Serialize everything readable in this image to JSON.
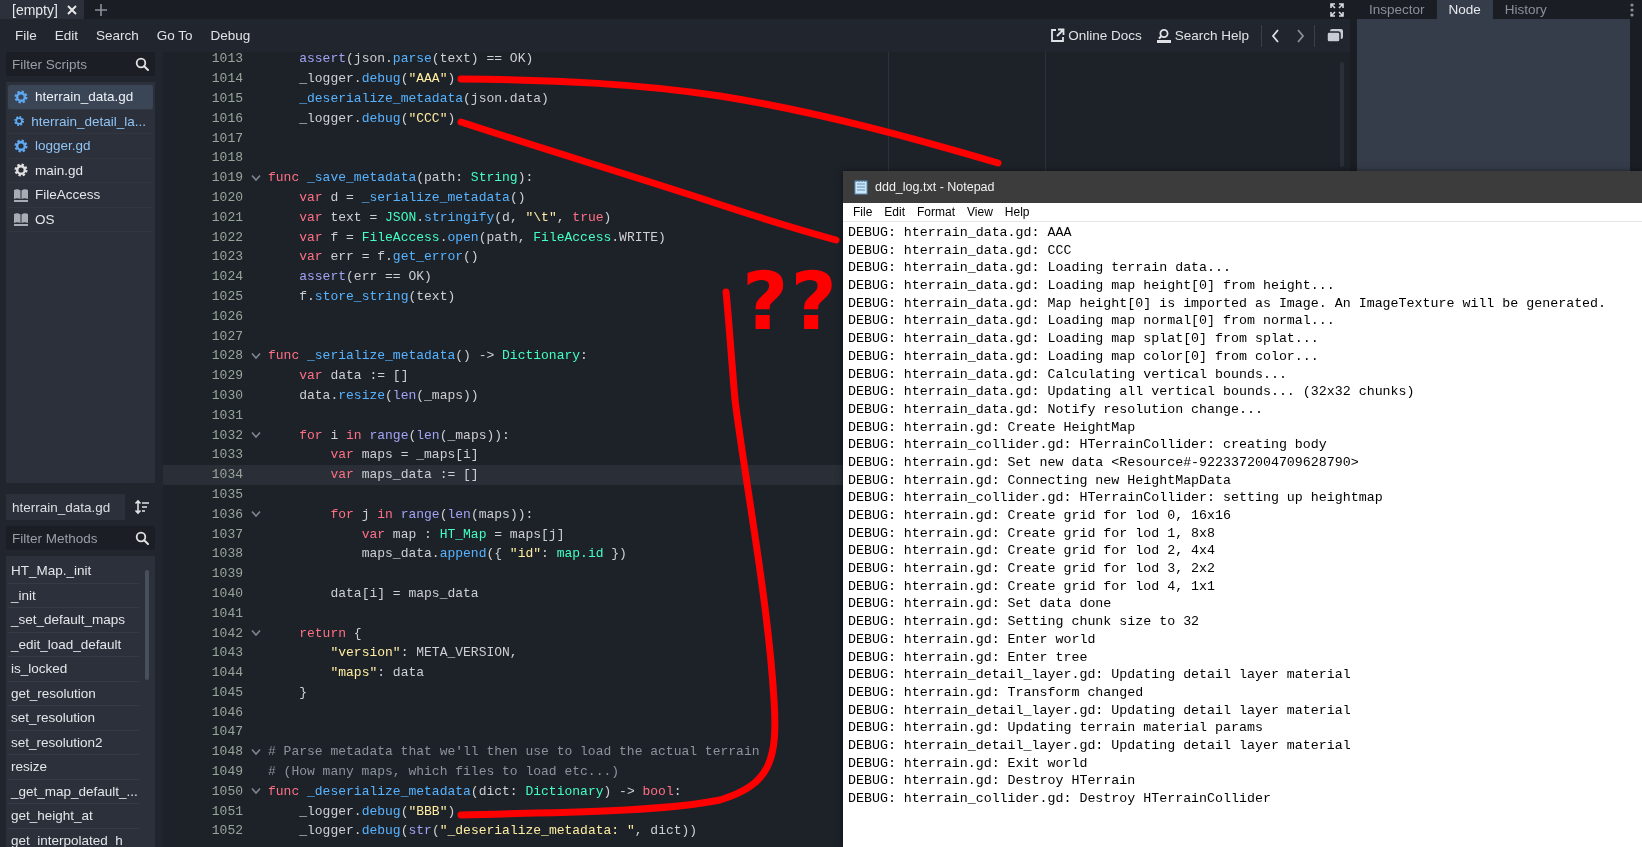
{
  "editor": {
    "tabs": [
      {
        "label": "[empty]",
        "selected": true
      }
    ],
    "menu": [
      "File",
      "Edit",
      "Search",
      "Go To",
      "Debug"
    ],
    "toolbar": [
      {
        "kind": "docs",
        "label": "Online Docs"
      },
      {
        "kind": "help",
        "label": "Search Help"
      }
    ],
    "script_filter": {
      "placeholder": "Filter Scripts"
    },
    "scripts": [
      {
        "name": "hterrain_data.gd",
        "kind": "tool_script",
        "selected": true
      },
      {
        "name": "hterrain_detail_la...",
        "kind": "tool_script",
        "selected": false
      },
      {
        "name": "logger.gd",
        "kind": "tool_script",
        "selected": false
      },
      {
        "name": "main.gd",
        "kind": "script",
        "selected": false
      },
      {
        "name": "FileAccess",
        "kind": "doc",
        "selected": false
      },
      {
        "name": "OS",
        "kind": "doc",
        "selected": false
      }
    ],
    "current_script": "hterrain_data.gd",
    "method_filter": {
      "placeholder": "Filter Methods"
    },
    "methods": [
      "HT_Map._init",
      "_init",
      "_set_default_maps",
      "_edit_load_default",
      "is_locked",
      "get_resolution",
      "set_resolution",
      "set_resolution2",
      "resize",
      "_get_map_default_...",
      "get_height_at",
      "get_interpolated_h"
    ],
    "code": {
      "lines": [
        {
          "number": "1013",
          "foldable": false,
          "selected": false,
          "tokens": [
            {
              "kind": "builtin",
              "text": "\tassert"
            },
            {
              "kind": "plain",
              "text": "(json."
            },
            {
              "kind": "function",
              "text": "parse"
            },
            {
              "kind": "plain",
              "text": "(text) == OK)"
            }
          ]
        },
        {
          "number": "1014",
          "foldable": false,
          "selected": false,
          "tokens": [
            {
              "kind": "plain",
              "text": "\t_logger."
            },
            {
              "kind": "function",
              "text": "debug"
            },
            {
              "kind": "plain",
              "text": "("
            },
            {
              "kind": "string",
              "text": "\"AAA\""
            },
            {
              "kind": "plain",
              "text": ")"
            }
          ]
        },
        {
          "number": "1015",
          "foldable": false,
          "selected": false,
          "tokens": [
            {
              "kind": "function",
              "text": "\t_deserialize_metadata"
            },
            {
              "kind": "plain",
              "text": "(json.data)"
            }
          ]
        },
        {
          "number": "1016",
          "foldable": false,
          "selected": false,
          "tokens": [
            {
              "kind": "plain",
              "text": "\t_logger."
            },
            {
              "kind": "function",
              "text": "debug"
            },
            {
              "kind": "plain",
              "text": "("
            },
            {
              "kind": "string",
              "text": "\"CCC\""
            },
            {
              "kind": "plain",
              "text": ")"
            }
          ]
        },
        {
          "number": "1017",
          "foldable": false,
          "selected": false
        },
        {
          "number": "1018",
          "foldable": false,
          "selected": false
        },
        {
          "number": "1019",
          "foldable": true,
          "selected": false,
          "tokens": [
            {
              "kind": "keyword",
              "text": "func"
            },
            {
              "kind": "function",
              "text": " _save_metadata"
            },
            {
              "kind": "plain",
              "text": "(path: "
            },
            {
              "kind": "type",
              "text": "String"
            },
            {
              "kind": "plain",
              "text": "):"
            }
          ]
        },
        {
          "number": "1020",
          "foldable": false,
          "selected": false,
          "tokens": [
            {
              "kind": "keyword",
              "text": "\tvar"
            },
            {
              "kind": "plain",
              "text": " d = "
            },
            {
              "kind": "function",
              "text": "_serialize_metadata"
            },
            {
              "kind": "plain",
              "text": "()"
            }
          ]
        },
        {
          "number": "1021",
          "foldable": false,
          "selected": false,
          "tokens": [
            {
              "kind": "keyword",
              "text": "\tvar"
            },
            {
              "kind": "plain",
              "text": " text = "
            },
            {
              "kind": "type",
              "text": "JSON"
            },
            {
              "kind": "plain",
              "text": "."
            },
            {
              "kind": "function",
              "text": "stringify"
            },
            {
              "kind": "plain",
              "text": "(d, "
            },
            {
              "kind": "string",
              "text": "\"\\t\""
            },
            {
              "kind": "plain",
              "text": ", "
            },
            {
              "kind": "keyword",
              "text": "true"
            },
            {
              "kind": "plain",
              "text": ")"
            }
          ]
        },
        {
          "number": "1022",
          "foldable": false,
          "selected": false,
          "tokens": [
            {
              "kind": "keyword",
              "text": "\tvar"
            },
            {
              "kind": "plain",
              "text": " f = "
            },
            {
              "kind": "type",
              "text": "FileAccess"
            },
            {
              "kind": "plain",
              "text": "."
            },
            {
              "kind": "function",
              "text": "open"
            },
            {
              "kind": "plain",
              "text": "(path, "
            },
            {
              "kind": "type",
              "text": "FileAccess"
            },
            {
              "kind": "plain",
              "text": ".WRITE)"
            }
          ]
        },
        {
          "number": "1023",
          "foldable": false,
          "selected": false,
          "tokens": [
            {
              "kind": "keyword",
              "text": "\tvar"
            },
            {
              "kind": "plain",
              "text": " err = f."
            },
            {
              "kind": "function",
              "text": "get_error"
            },
            {
              "kind": "plain",
              "text": "()"
            }
          ]
        },
        {
          "number": "1024",
          "foldable": false,
          "selected": false,
          "tokens": [
            {
              "kind": "builtin",
              "text": "\tassert"
            },
            {
              "kind": "plain",
              "text": "(err == OK)"
            }
          ]
        },
        {
          "number": "1025",
          "foldable": false,
          "selected": false,
          "tokens": [
            {
              "kind": "plain",
              "text": "\tf."
            },
            {
              "kind": "function",
              "text": "store_string"
            },
            {
              "kind": "plain",
              "text": "(text)"
            }
          ]
        },
        {
          "number": "1026",
          "foldable": false,
          "selected": false
        },
        {
          "number": "1027",
          "foldable": false,
          "selected": false
        },
        {
          "number": "1028",
          "foldable": true,
          "selected": false,
          "tokens": [
            {
              "kind": "keyword",
              "text": "func"
            },
            {
              "kind": "function",
              "text": " _serialize_metadata"
            },
            {
              "kind": "plain",
              "text": "() -> "
            },
            {
              "kind": "type",
              "text": "Dictionary"
            },
            {
              "kind": "plain",
              "text": ":"
            }
          ]
        },
        {
          "number": "1029",
          "foldable": false,
          "selected": false,
          "tokens": [
            {
              "kind": "keyword",
              "text": "\tvar"
            },
            {
              "kind": "plain",
              "text": " data := []"
            }
          ]
        },
        {
          "number": "1030",
          "foldable": false,
          "selected": false,
          "tokens": [
            {
              "kind": "plain",
              "text": "\tdata."
            },
            {
              "kind": "function",
              "text": "resize"
            },
            {
              "kind": "plain",
              "text": "("
            },
            {
              "kind": "builtin",
              "text": "len"
            },
            {
              "kind": "plain",
              "text": "(_maps))"
            }
          ]
        },
        {
          "number": "1031",
          "foldable": false,
          "selected": false
        },
        {
          "number": "1032",
          "foldable": true,
          "selected": false,
          "tokens": [
            {
              "kind": "keyword",
              "text": "\tfor"
            },
            {
              "kind": "plain",
              "text": " i "
            },
            {
              "kind": "keyword",
              "text": "in"
            },
            {
              "kind": "builtin",
              "text": " range"
            },
            {
              "kind": "plain",
              "text": "("
            },
            {
              "kind": "builtin",
              "text": "len"
            },
            {
              "kind": "plain",
              "text": "(_maps)):"
            }
          ]
        },
        {
          "number": "1033",
          "foldable": false,
          "selected": false,
          "tokens": [
            {
              "kind": "keyword",
              "text": "\t\tvar"
            },
            {
              "kind": "plain",
              "text": " maps = _maps[i]"
            }
          ]
        },
        {
          "number": "1034",
          "foldable": false,
          "selected": true,
          "tokens": [
            {
              "kind": "keyword",
              "text": "\t\tvar"
            },
            {
              "kind": "plain",
              "text": " maps_data := []"
            }
          ]
        },
        {
          "number": "1035",
          "foldable": false,
          "selected": false
        },
        {
          "number": "1036",
          "foldable": true,
          "selected": false,
          "tokens": [
            {
              "kind": "keyword",
              "text": "\t\tfor"
            },
            {
              "kind": "plain",
              "text": " j "
            },
            {
              "kind": "keyword",
              "text": "in"
            },
            {
              "kind": "builtin",
              "text": " range"
            },
            {
              "kind": "plain",
              "text": "("
            },
            {
              "kind": "builtin",
              "text": "len"
            },
            {
              "kind": "plain",
              "text": "(maps)):"
            }
          ]
        },
        {
          "number": "1037",
          "foldable": false,
          "selected": false,
          "tokens": [
            {
              "kind": "keyword",
              "text": "\t\t\tvar"
            },
            {
              "kind": "plain",
              "text": " map : "
            },
            {
              "kind": "type",
              "text": "HT_Map"
            },
            {
              "kind": "plain",
              "text": " = maps[j]"
            }
          ]
        },
        {
          "number": "1038",
          "foldable": false,
          "selected": false,
          "tokens": [
            {
              "kind": "plain",
              "text": "\t\t\tmaps_data."
            },
            {
              "kind": "function",
              "text": "append"
            },
            {
              "kind": "plain",
              "text": "({ "
            },
            {
              "kind": "string",
              "text": "\"id\""
            },
            {
              "kind": "plain",
              "text": ": "
            },
            {
              "kind": "member",
              "text": "map.id"
            },
            {
              "kind": "plain",
              "text": " })"
            }
          ]
        },
        {
          "number": "1039",
          "foldable": false,
          "selected": false
        },
        {
          "number": "1040",
          "foldable": false,
          "selected": false,
          "tokens": [
            {
              "kind": "plain",
              "text": "\t\tdata[i] = maps_data"
            }
          ]
        },
        {
          "number": "1041",
          "foldable": false,
          "selected": false
        },
        {
          "number": "1042",
          "foldable": true,
          "selected": false,
          "tokens": [
            {
              "kind": "keyword",
              "text": "\treturn"
            },
            {
              "kind": "plain",
              "text": " {"
            }
          ]
        },
        {
          "number": "1043",
          "foldable": false,
          "selected": false,
          "tokens": [
            {
              "kind": "string",
              "text": "\t\t\"version\""
            },
            {
              "kind": "plain",
              "text": ": META_VERSION,"
            }
          ]
        },
        {
          "number": "1044",
          "foldable": false,
          "selected": false,
          "tokens": [
            {
              "kind": "string",
              "text": "\t\t\"maps\""
            },
            {
              "kind": "plain",
              "text": ": data"
            }
          ]
        },
        {
          "number": "1045",
          "foldable": false,
          "selected": false,
          "tokens": [
            {
              "kind": "plain",
              "text": "\t}"
            }
          ]
        },
        {
          "number": "1046",
          "foldable": false,
          "selected": false
        },
        {
          "number": "1047",
          "foldable": false,
          "selected": false
        },
        {
          "number": "1048",
          "foldable": true,
          "selected": false,
          "tokens": [
            {
              "kind": "comment",
              "text": "# Parse metadata that we'll then use to load the actual terrain"
            }
          ]
        },
        {
          "number": "1049",
          "foldable": false,
          "selected": false,
          "tokens": [
            {
              "kind": "comment",
              "text": "# (How many maps, which files to load etc...)"
            }
          ]
        },
        {
          "number": "1050",
          "foldable": true,
          "selected": false,
          "tokens": [
            {
              "kind": "keyword",
              "text": "func"
            },
            {
              "kind": "function",
              "text": " _deserialize_metadata"
            },
            {
              "kind": "plain",
              "text": "(dict: "
            },
            {
              "kind": "type",
              "text": "Dictionary"
            },
            {
              "kind": "plain",
              "text": ") -> "
            },
            {
              "kind": "keyword",
              "text": "bool"
            },
            {
              "kind": "plain",
              "text": ":"
            }
          ]
        },
        {
          "number": "1051",
          "foldable": false,
          "selected": false,
          "tokens": [
            {
              "kind": "plain",
              "text": "\t_logger."
            },
            {
              "kind": "function",
              "text": "debug"
            },
            {
              "kind": "plain",
              "text": "("
            },
            {
              "kind": "string",
              "text": "\"BBB\""
            },
            {
              "kind": "plain",
              "text": ")"
            }
          ]
        },
        {
          "number": "1052",
          "foldable": false,
          "selected": false,
          "tokens": [
            {
              "kind": "plain",
              "text": "\t_logger."
            },
            {
              "kind": "function",
              "text": "debug"
            },
            {
              "kind": "plain",
              "text": "("
            },
            {
              "kind": "builtin",
              "text": "str"
            },
            {
              "kind": "plain",
              "text": "("
            },
            {
              "kind": "string",
              "text": "\"_deserialize_metadata: \""
            },
            {
              "kind": "plain",
              "text": ", dict))"
            }
          ]
        }
      ]
    }
  },
  "dock": {
    "tabs": [
      {
        "label": "Inspector",
        "selected": false
      },
      {
        "label": "Node",
        "selected": true
      },
      {
        "label": "History",
        "selected": false
      }
    ]
  },
  "notepad": {
    "title": "ddd_log.txt - Notepad",
    "menu": [
      "File",
      "Edit",
      "Format",
      "View",
      "Help"
    ],
    "lines": [
      "DEBUG: hterrain_data.gd: AAA",
      "DEBUG: hterrain_data.gd: CCC",
      "DEBUG: hterrain_data.gd: Loading terrain data...",
      "DEBUG: hterrain_data.gd: Loading map height[0] from height...",
      "DEBUG: hterrain_data.gd: Map height[0] is imported as Image. An ImageTexture will be generated.",
      "DEBUG: hterrain_data.gd: Loading map normal[0] from normal...",
      "DEBUG: hterrain_data.gd: Loading map splat[0] from splat...",
      "DEBUG: hterrain_data.gd: Loading map color[0] from color...",
      "DEBUG: hterrain_data.gd: Calculating vertical bounds...",
      "DEBUG: hterrain_data.gd: Updating all vertical bounds... (32x32 chunks)",
      "DEBUG: hterrain_data.gd: Notify resolution change...",
      "DEBUG: hterrain.gd: Create HeightMap",
      "DEBUG: hterrain_collider.gd: HTerrainCollider: creating body",
      "DEBUG: hterrain.gd: Set new data <Resource#-9223372004709628790>",
      "DEBUG: hterrain.gd: Connecting new HeightMapData",
      "DEBUG: hterrain_collider.gd: HTerrainCollider: setting up heightmap",
      "DEBUG: hterrain.gd: Create grid for lod 0, 16x16",
      "DEBUG: hterrain.gd: Create grid for lod 1, 8x8",
      "DEBUG: hterrain.gd: Create grid for lod 2, 4x4",
      "DEBUG: hterrain.gd: Create grid for lod 3, 2x2",
      "DEBUG: hterrain.gd: Create grid for lod 4, 1x1",
      "DEBUG: hterrain.gd: Set data done",
      "DEBUG: hterrain.gd: Setting chunk size to 32",
      "DEBUG: hterrain.gd: Enter world",
      "DEBUG: hterrain.gd: Enter tree",
      "DEBUG: hterrain_detail_layer.gd: Updating detail layer material",
      "DEBUG: hterrain.gd: Transform changed",
      "DEBUG: hterrain_detail_layer.gd: Updating detail layer material",
      "DEBUG: hterrain.gd: Updating terrain material params",
      "DEBUG: hterrain_detail_layer.gd: Updating detail layer material",
      "DEBUG: hterrain.gd: Exit world",
      "DEBUG: hterrain.gd: Destroy HTerrain",
      "DEBUG: hterrain_collider.gd: Destroy HTerrainCollider"
    ]
  },
  "annotation": {
    "marks": "??"
  }
}
